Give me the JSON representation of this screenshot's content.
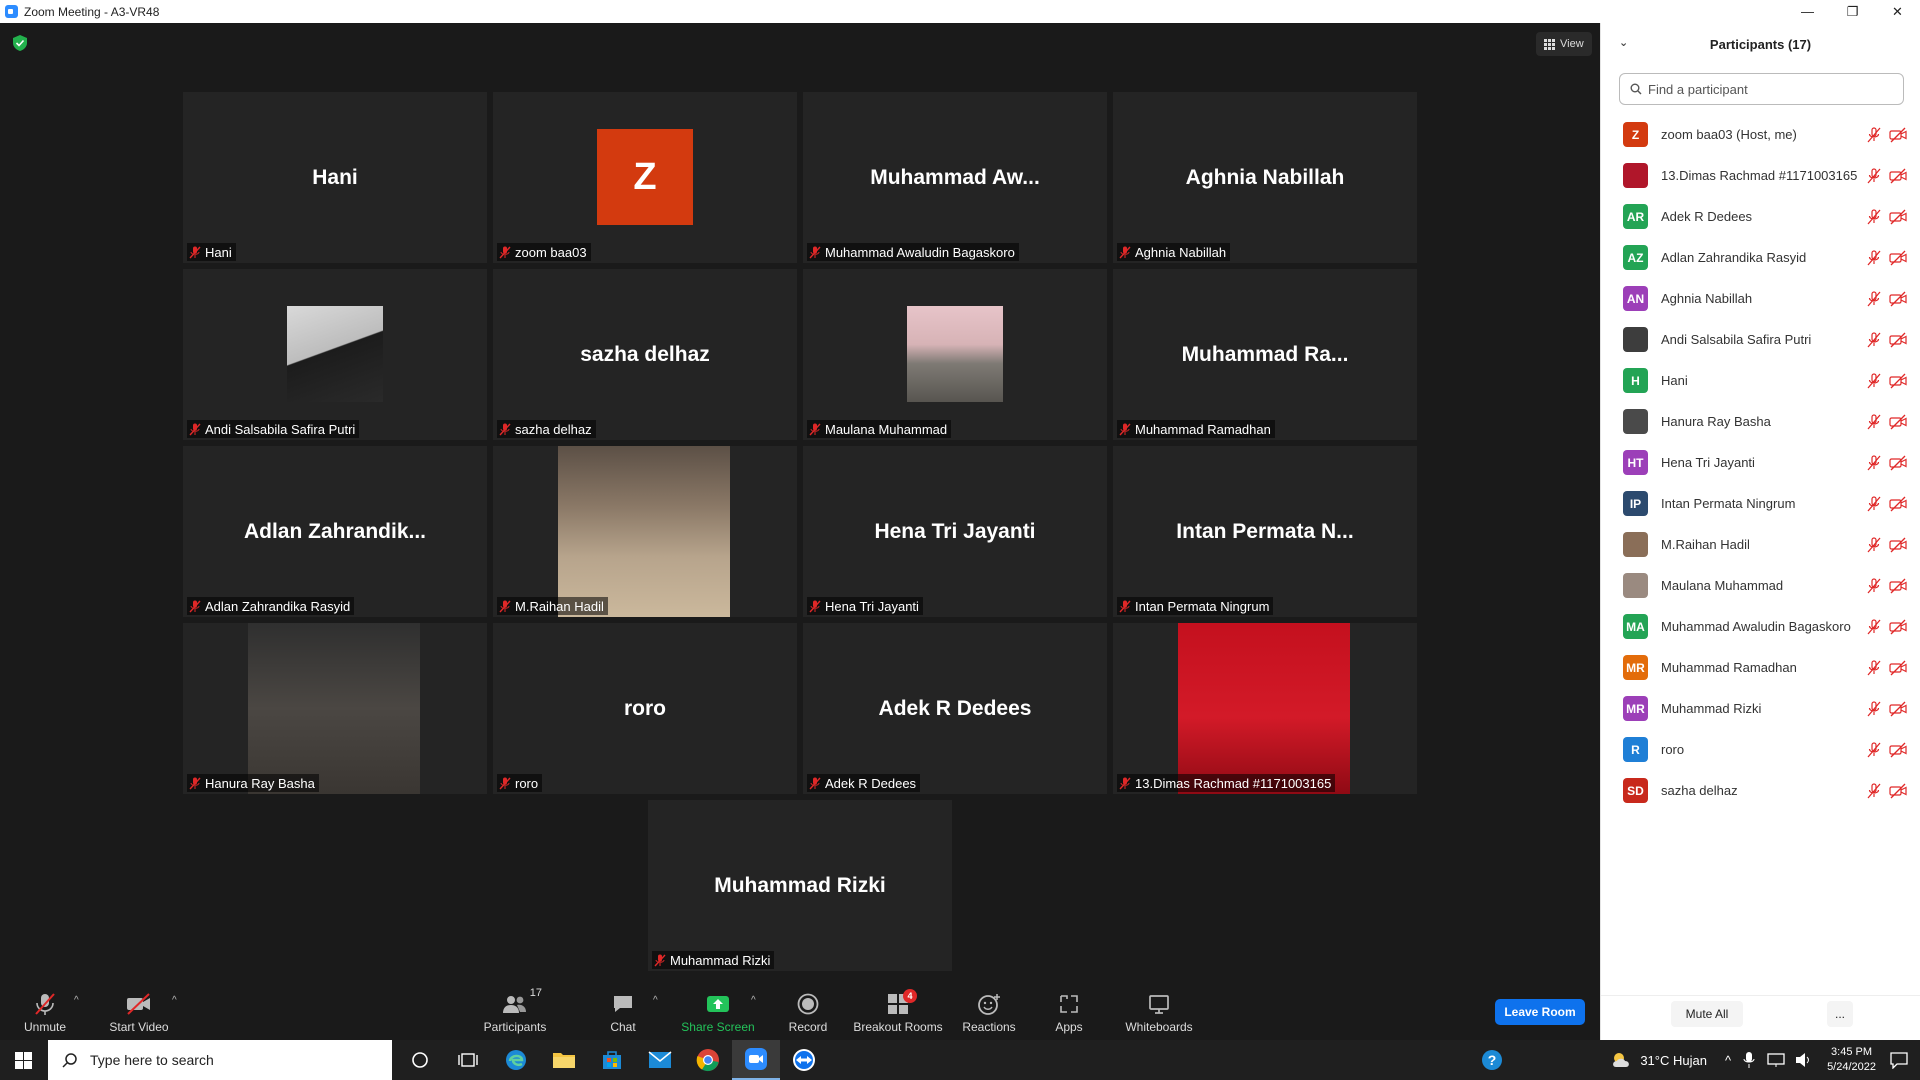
{
  "window": {
    "title": "Zoom Meeting - A3-VR48",
    "minimize": "—",
    "restore": "❐",
    "close": "✕"
  },
  "meeting": {
    "view_label": "View",
    "tiles": [
      {
        "big": "Hani",
        "label": "Hani"
      },
      {
        "avatar": "Z",
        "label": "zoom baa03"
      },
      {
        "big": "Muhammad  Aw...",
        "label": "Muhammad Awaludin Bagaskoro"
      },
      {
        "big": "Aghnia Nabillah",
        "label": "Aghnia Nabillah"
      },
      {
        "label": "Andi Salsabila Safira Putri"
      },
      {
        "big": "sazha delhaz",
        "label": "sazha delhaz"
      },
      {
        "label": "Maulana Muhammad"
      },
      {
        "big": "Muhammad  Ra...",
        "label": "Muhammad Ramadhan"
      },
      {
        "big": "Adlan  Zahrandik...",
        "label": "Adlan Zahrandika Rasyid"
      },
      {
        "label": "M.Raihan Hadil"
      },
      {
        "big": "Hena Tri Jayanti",
        "label": "Hena Tri Jayanti"
      },
      {
        "big": "Intan Permata  N...",
        "label": "Intan Permata Ningrum"
      },
      {
        "label": "Hanura Ray Basha"
      },
      {
        "big": "roro",
        "label": "roro"
      },
      {
        "big": "Adek R Dedees",
        "label": "Adek R Dedees"
      },
      {
        "label": "13.Dimas Rachmad #1171003165"
      },
      {
        "big": "Muhammad Rizki",
        "label": "Muhammad Rizki"
      }
    ]
  },
  "toolbar": {
    "unmute": "Unmute",
    "start_video": "Start Video",
    "participants": "Participants",
    "participants_count": "17",
    "chat": "Chat",
    "share_screen": "Share Screen",
    "record": "Record",
    "breakout_rooms": "Breakout Rooms",
    "breakout_badge": "4",
    "reactions": "Reactions",
    "apps": "Apps",
    "whiteboards": "Whiteboards",
    "leave": "Leave Room"
  },
  "panel": {
    "title": "Participants (17)",
    "search_placeholder": "Find a participant",
    "participants": [
      {
        "initials": "Z",
        "color": "#d33a0f",
        "name": "zoom baa03 (Host, me)"
      },
      {
        "initials": "",
        "color": "#b0162a",
        "name": "13.Dimas Rachmad #1171003165"
      },
      {
        "initials": "AR",
        "color": "#23a455",
        "name": "Adek R Dedees"
      },
      {
        "initials": "AZ",
        "color": "#23a455",
        "name": "Adlan Zahrandika Rasyid"
      },
      {
        "initials": "AN",
        "color": "#9c3fb8",
        "name": "Aghnia Nabillah"
      },
      {
        "initials": "",
        "color": "#3d3d3d",
        "name": "Andi Salsabila Safira Putri"
      },
      {
        "initials": "H",
        "color": "#23a455",
        "name": "Hani"
      },
      {
        "initials": "",
        "color": "#4a4a4a",
        "name": "Hanura Ray Basha"
      },
      {
        "initials": "HT",
        "color": "#9c3fb8",
        "name": "Hena Tri Jayanti"
      },
      {
        "initials": "IP",
        "color": "#2c4a6e",
        "name": "Intan Permata Ningrum"
      },
      {
        "initials": "",
        "color": "#8a6e58",
        "name": "M.Raihan Hadil"
      },
      {
        "initials": "",
        "color": "#9a8a80",
        "name": "Maulana Muhammad"
      },
      {
        "initials": "MA",
        "color": "#23a455",
        "name": "Muhammad Awaludin Bagaskoro"
      },
      {
        "initials": "MR",
        "color": "#e36c0a",
        "name": "Muhammad Ramadhan"
      },
      {
        "initials": "MR",
        "color": "#9c3fb8",
        "name": "Muhammad Rizki"
      },
      {
        "initials": "R",
        "color": "#1f7fd6",
        "name": "roro"
      },
      {
        "initials": "SD",
        "color": "#c8291c",
        "name": "sazha delhaz"
      }
    ],
    "mute_all": "Mute All",
    "more": "..."
  },
  "taskbar": {
    "search_placeholder": "Type here to search",
    "weather": "31°C  Hujan",
    "time": "3:45 PM",
    "date": "5/24/2022"
  }
}
